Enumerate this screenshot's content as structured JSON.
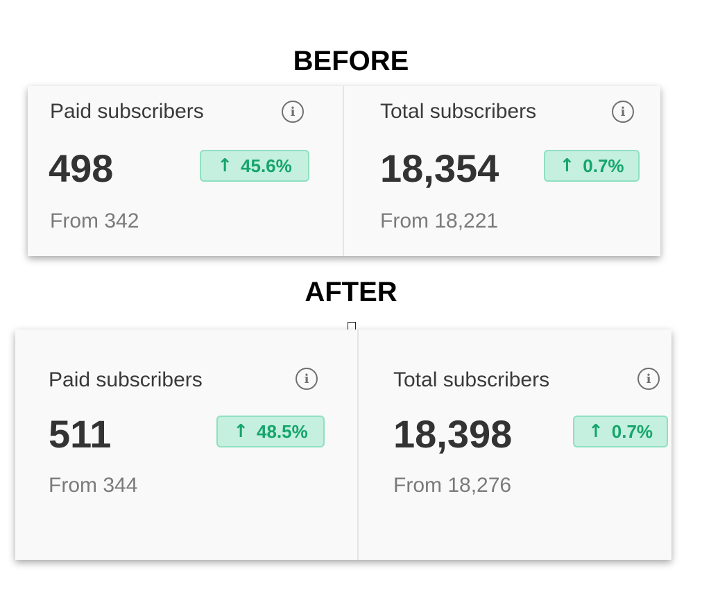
{
  "before": {
    "heading": "BEFORE",
    "paid": {
      "title": "Paid subscribers",
      "value": "498",
      "change": "45.6%",
      "from": "From 342"
    },
    "total": {
      "title": "Total subscribers",
      "value": "18,354",
      "change": "0.7%",
      "from": "From 18,221"
    }
  },
  "after": {
    "heading": "AFTER",
    "paid": {
      "title": "Paid subscribers",
      "value": "511",
      "change": "48.5%",
      "from": "From 344"
    },
    "total": {
      "title": "Total subscribers",
      "value": "18,398",
      "change": "0.7%",
      "from": "From 18,276"
    }
  },
  "icons": {
    "info": "info-icon",
    "trend": "arrow-up-icon"
  },
  "colors": {
    "badge_bg": "#c5efdf",
    "badge_text": "#16a56c",
    "panel_bg": "#f9f9f9"
  }
}
